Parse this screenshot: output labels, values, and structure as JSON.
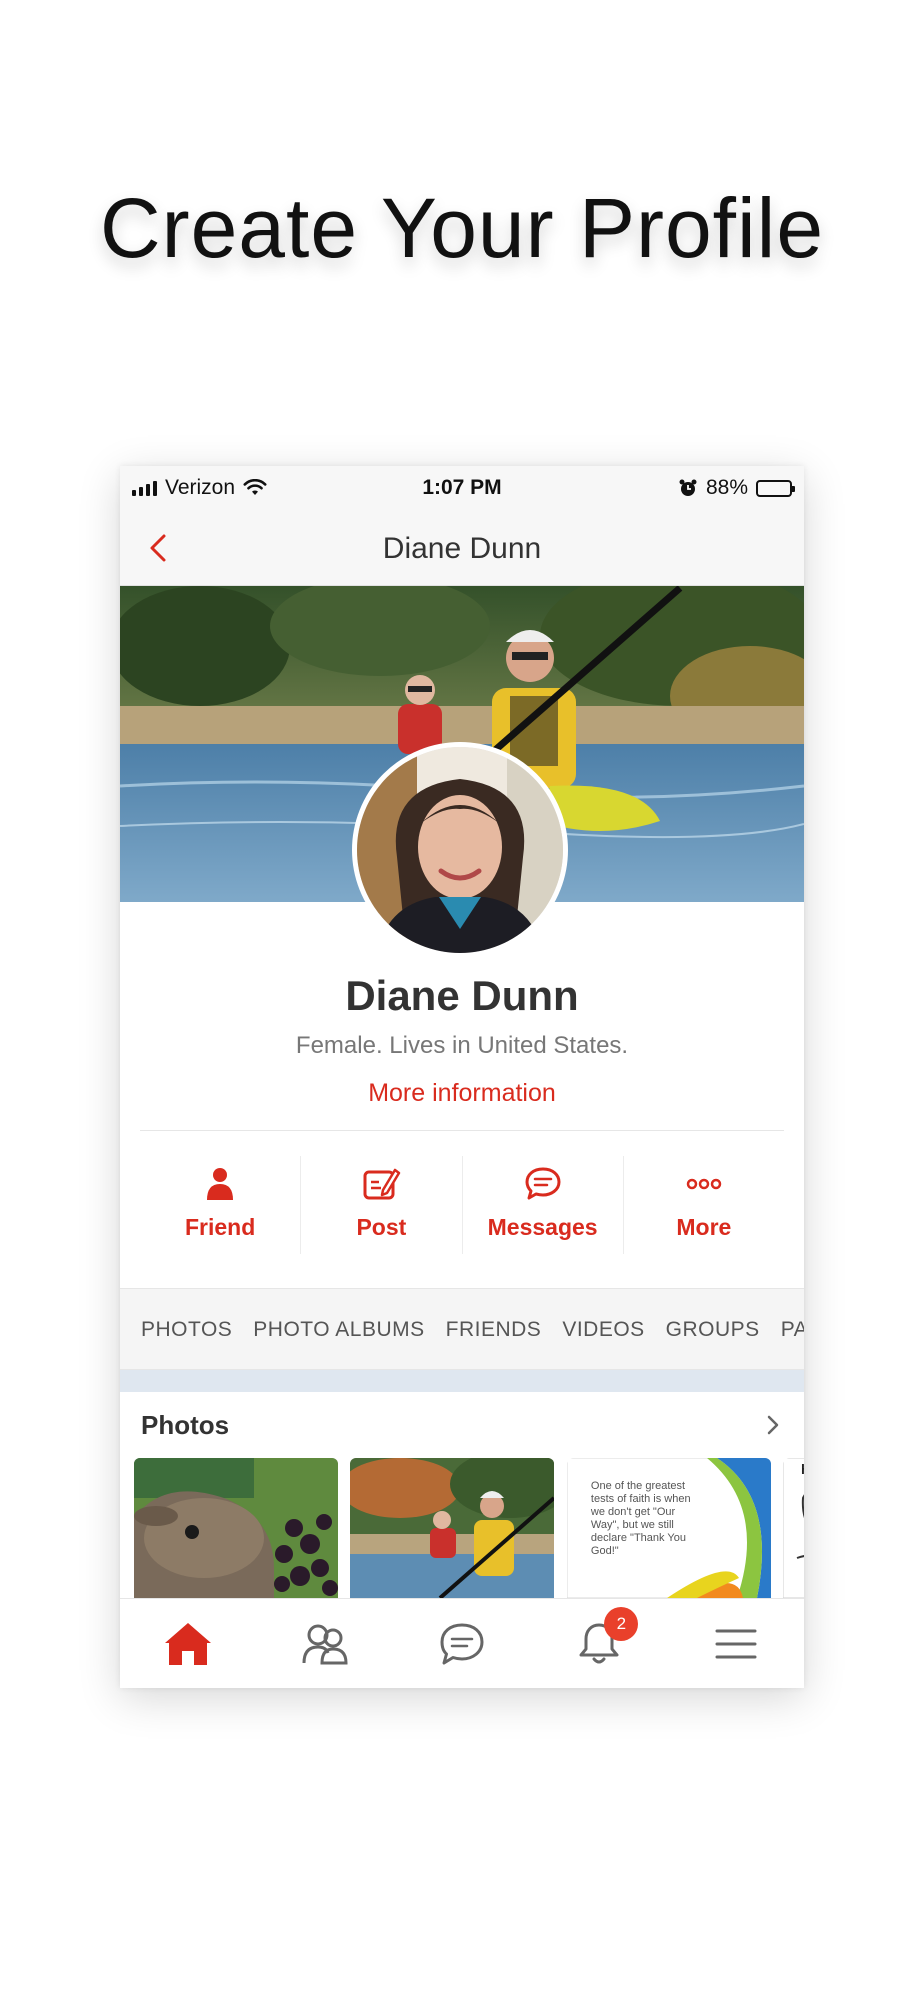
{
  "headline": "Create Your Profile",
  "status_bar": {
    "carrier": "Verizon",
    "time": "1:07 PM",
    "battery_percent": "88%",
    "battery_level": 0.88,
    "icons": [
      "signal-icon",
      "wifi-icon",
      "alarm-icon",
      "battery-icon"
    ]
  },
  "nav": {
    "title": "Diane Dunn",
    "back_icon": "chevron-left-icon"
  },
  "profile": {
    "name": "Diane Dunn",
    "details": "Female. Lives in United States.",
    "more_info_link": "More information"
  },
  "actions": [
    {
      "label": "Friend",
      "icon": "person-icon"
    },
    {
      "label": "Post",
      "icon": "compose-icon"
    },
    {
      "label": "Messages",
      "icon": "chat-bubble-icon"
    },
    {
      "label": "More",
      "icon": "more-dots-icon"
    }
  ],
  "tabs": [
    "PHOTOS",
    "PHOTO ALBUMS",
    "FRIENDS",
    "VIDEOS",
    "GROUPS",
    "PA"
  ],
  "photos_section": {
    "title": "Photos",
    "thumbnails": [
      {
        "subject": "deer eating berries"
      },
      {
        "subject": "kayaking couple"
      },
      {
        "subject": "quote card",
        "text": "One of the greatest tests of faith is when we don't get \"Our Way\", but we still declare \"Thank You God!\""
      },
      {
        "subject": "comic"
      }
    ]
  },
  "tab_bar": {
    "items": [
      "home-icon",
      "friends-icon",
      "messages-icon",
      "notifications-icon",
      "menu-icon"
    ],
    "notification_count": "2"
  },
  "colors": {
    "accent": "#d92b1e",
    "badge": "#e9402b",
    "bar_bg": "#f7f7f7"
  }
}
